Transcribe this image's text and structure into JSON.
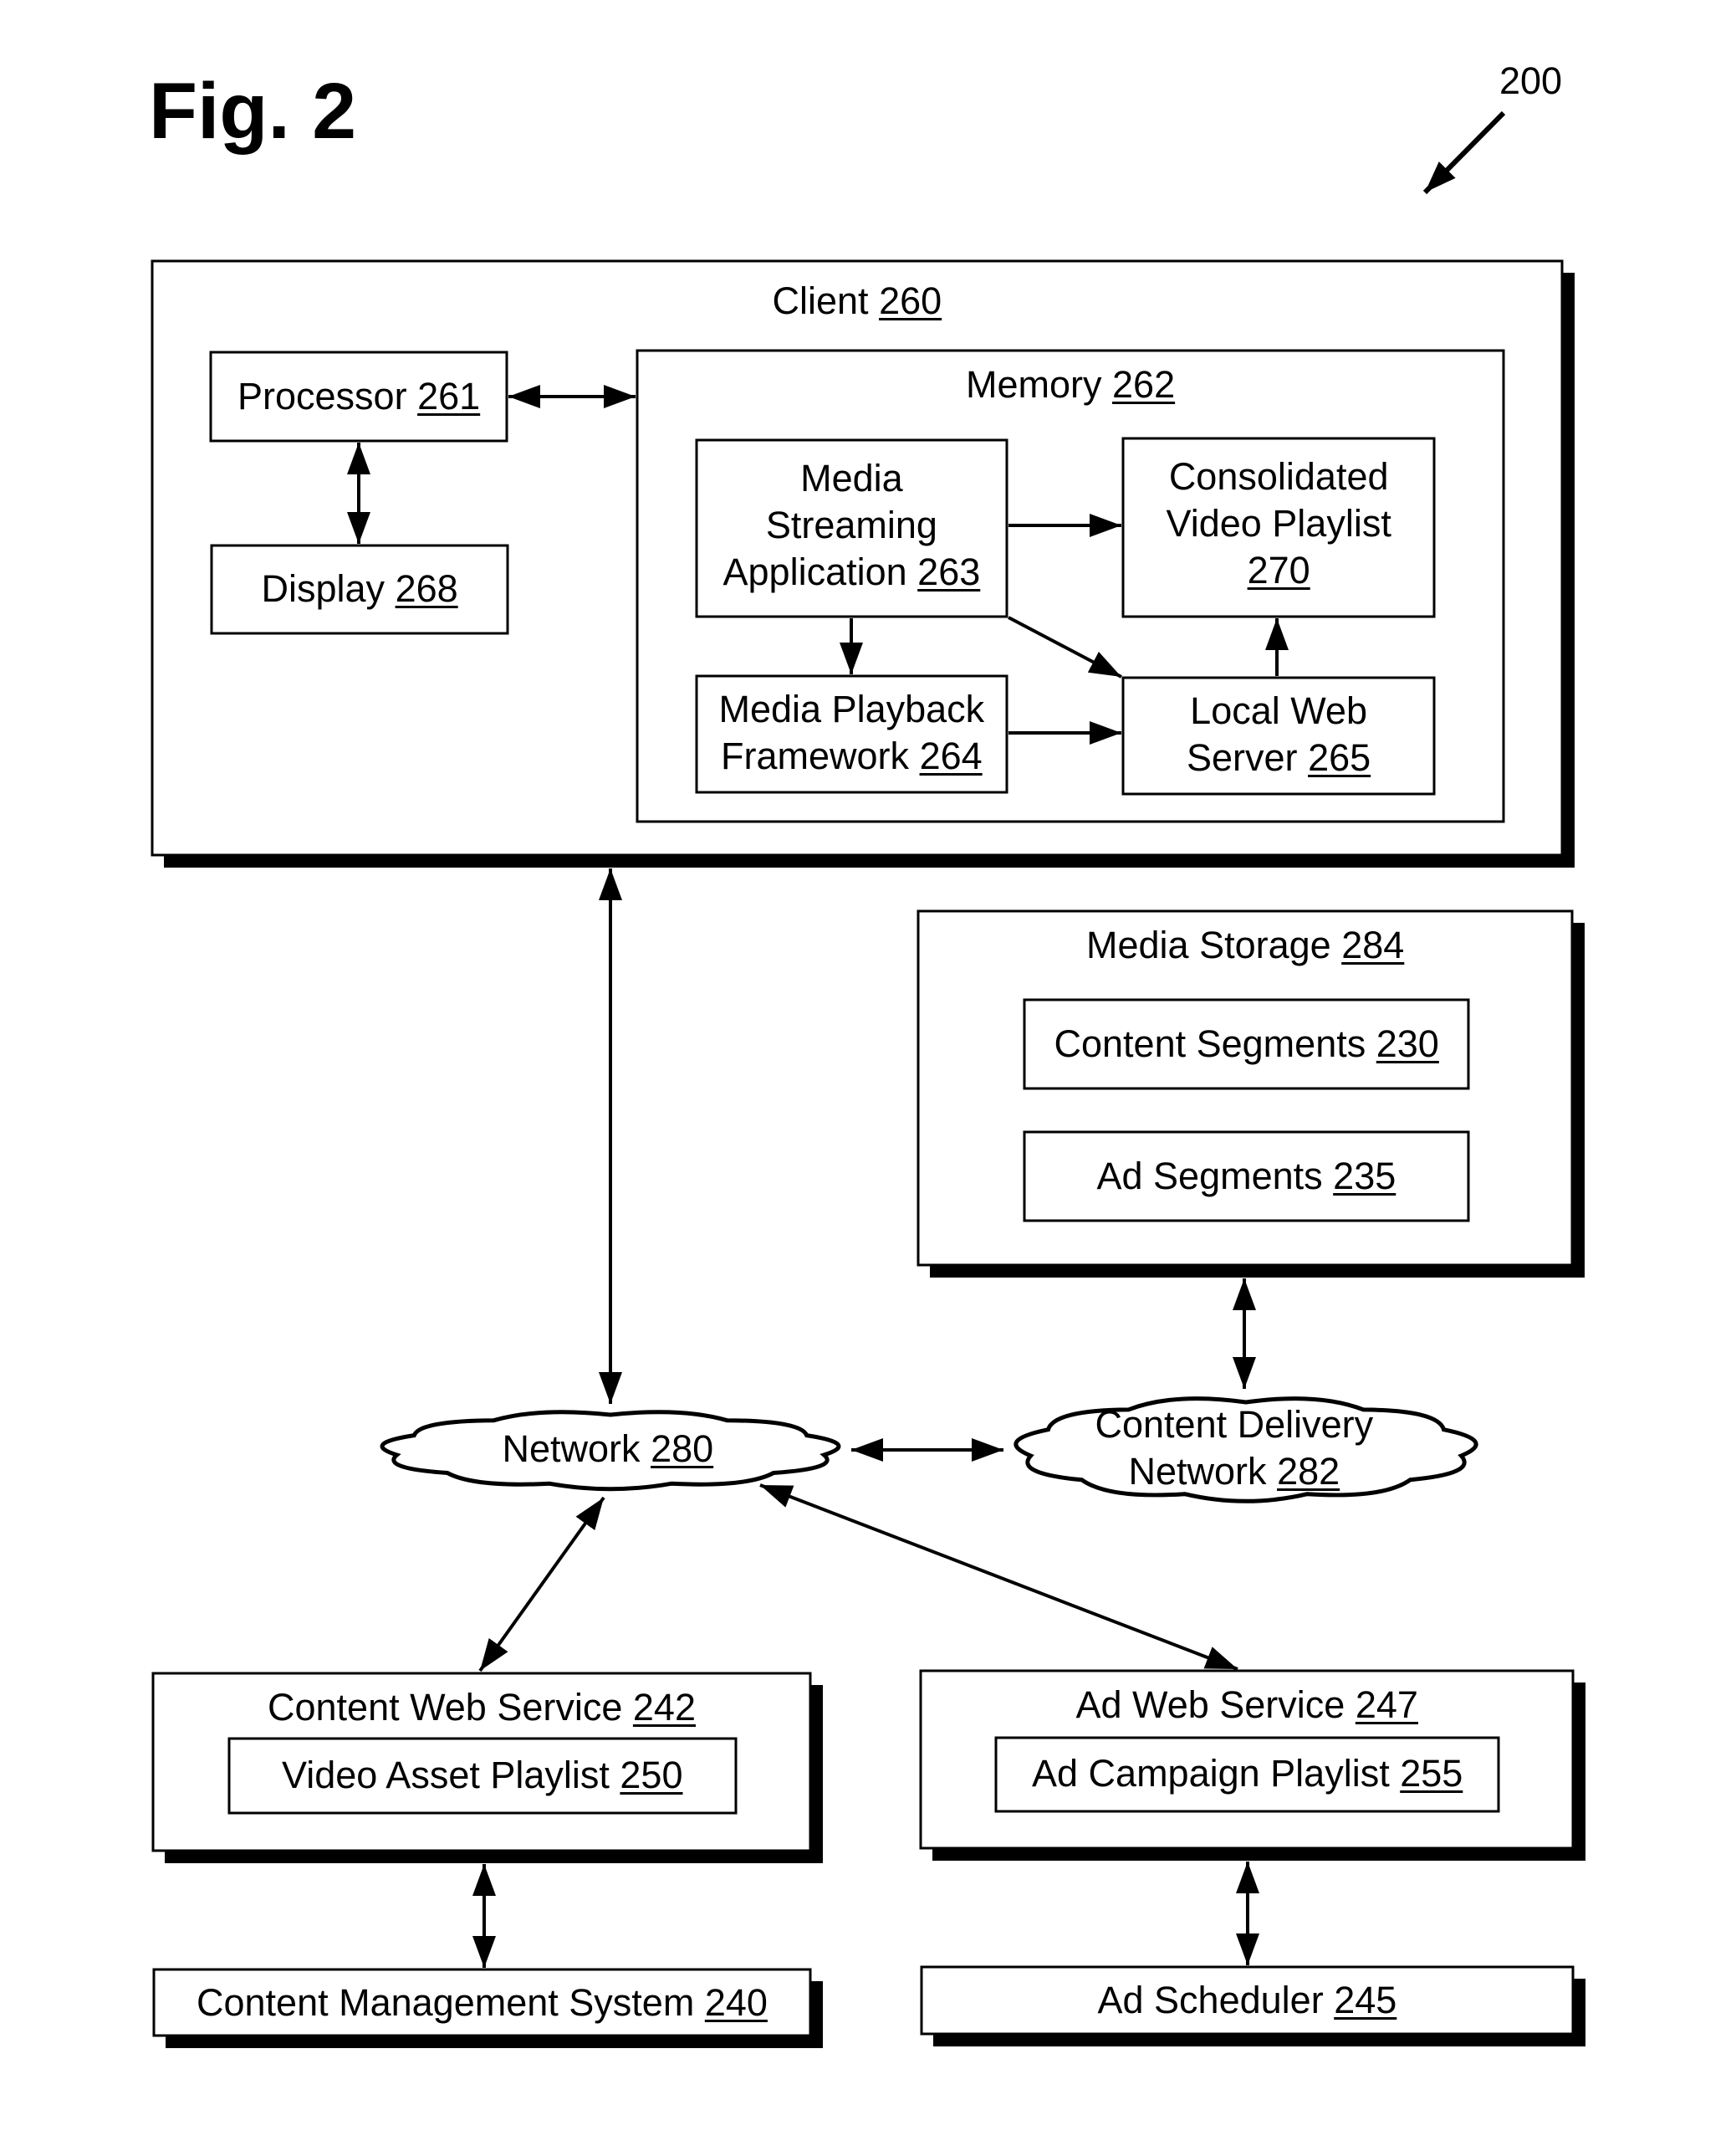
{
  "figure": {
    "title": "Fig. 2",
    "reference_number": "200"
  },
  "nodes": {
    "client": {
      "name": "Client",
      "ref": "260"
    },
    "processor": {
      "name": "Processor",
      "ref": "261"
    },
    "display": {
      "name": "Display",
      "ref": "268"
    },
    "memory": {
      "name": "Memory",
      "ref": "262"
    },
    "media_streaming_app": {
      "lines": [
        "Media",
        "Streaming",
        "Application"
      ],
      "ref": "263"
    },
    "consolidated_playlist": {
      "lines": [
        "Consolidated",
        "Video Playlist"
      ],
      "ref": "270"
    },
    "media_playback_framework": {
      "lines": [
        "Media Playback",
        "Framework"
      ],
      "ref": "264"
    },
    "local_web_server": {
      "lines": [
        "Local Web",
        "Server"
      ],
      "ref": "265"
    },
    "media_storage": {
      "name": "Media Storage",
      "ref": "284"
    },
    "content_segments": {
      "name": "Content Segments",
      "ref": "230"
    },
    "ad_segments": {
      "name": "Ad Segments",
      "ref": "235"
    },
    "network": {
      "name": "Network",
      "ref": "280"
    },
    "cdn": {
      "lines": [
        "Content Delivery",
        "Network"
      ],
      "ref": "282"
    },
    "content_web_service": {
      "name": "Content Web Service",
      "ref": "242"
    },
    "video_asset_playlist": {
      "name": "Video Asset Playlist",
      "ref": "250"
    },
    "ad_web_service": {
      "name": "Ad Web Service",
      "ref": "247"
    },
    "ad_campaign_playlist": {
      "name": "Ad Campaign Playlist",
      "ref": "255"
    },
    "content_management_system": {
      "name": "Content Management System",
      "ref": "240"
    },
    "ad_scheduler": {
      "name": "Ad Scheduler",
      "ref": "245"
    }
  },
  "connections": [
    {
      "from": "processor",
      "to": "memory",
      "direction": "both"
    },
    {
      "from": "processor",
      "to": "display",
      "direction": "both"
    },
    {
      "from": "media_streaming_app",
      "to": "consolidated_playlist",
      "direction": "forward"
    },
    {
      "from": "media_streaming_app",
      "to": "media_playback_framework",
      "direction": "forward"
    },
    {
      "from": "media_streaming_app",
      "to": "local_web_server",
      "direction": "forward"
    },
    {
      "from": "media_playback_framework",
      "to": "local_web_server",
      "direction": "forward"
    },
    {
      "from": "local_web_server",
      "to": "consolidated_playlist",
      "direction": "forward"
    },
    {
      "from": "client",
      "to": "network",
      "direction": "both"
    },
    {
      "from": "media_storage",
      "to": "cdn",
      "direction": "both"
    },
    {
      "from": "network",
      "to": "cdn",
      "direction": "both"
    },
    {
      "from": "network",
      "to": "content_web_service",
      "direction": "both"
    },
    {
      "from": "network",
      "to": "ad_web_service",
      "direction": "both"
    },
    {
      "from": "content_web_service",
      "to": "content_management_system",
      "direction": "both"
    },
    {
      "from": "ad_web_service",
      "to": "ad_scheduler",
      "direction": "both"
    }
  ]
}
